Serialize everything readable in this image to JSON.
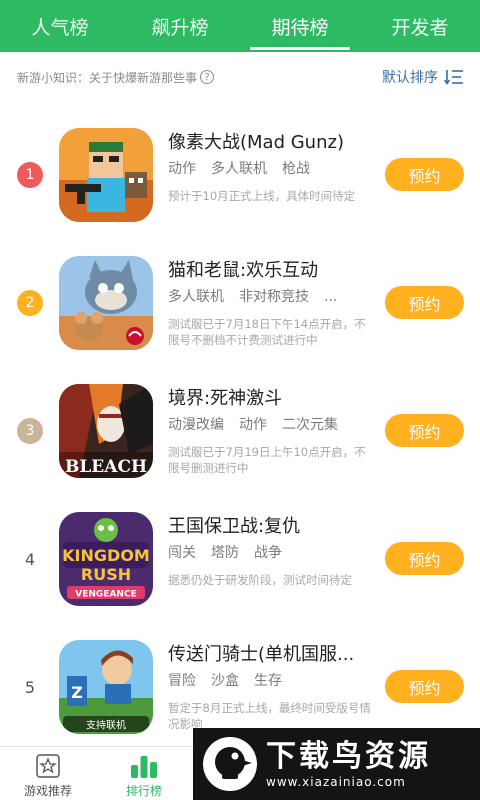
{
  "tabs": [
    {
      "label": "人气榜"
    },
    {
      "label": "飙升榜"
    },
    {
      "label": "期待榜",
      "active": true
    },
    {
      "label": "开发者"
    }
  ],
  "tip": {
    "text": "新游小知识：关于快爆新游那些事",
    "help_icon": "?"
  },
  "sort": {
    "label": "默认排序"
  },
  "items": [
    {
      "rank": "1",
      "rank_color": "#f05a5a",
      "title": "像素大战(Mad Gunz)",
      "tags": [
        "动作",
        "多人联机",
        "枪战"
      ],
      "desc": "预计于10月正式上线，具体时间待定",
      "button": "预约"
    },
    {
      "rank": "2",
      "rank_color": "#ffb11f",
      "title": "猫和老鼠:欢乐互动",
      "tags": [
        "多人联机",
        "非对称竞技",
        "..."
      ],
      "desc": "测试服已于7月18日下午14点开启，不限号不删档不计费测试进行中",
      "button": "预约"
    },
    {
      "rank": "3",
      "rank_color": "#c9b49a",
      "title": "境界:死神激斗",
      "tags": [
        "动漫改编",
        "动作",
        "二次元集"
      ],
      "desc": "测试服已于7月19日上午10点开启，不限号删测进行中",
      "button": "预约"
    },
    {
      "rank": "4",
      "rank_color": "",
      "title": "王国保卫战:复仇",
      "tags": [
        "闯关",
        "塔防",
        "战争"
      ],
      "desc": "据悉仍处于研发阶段，测试时间待定",
      "button": "预约"
    },
    {
      "rank": "5",
      "rank_color": "",
      "title": "传送门骑士(单机国服...",
      "tags": [
        "冒险",
        "沙盒",
        "生存"
      ],
      "desc": "暂定于8月正式上线，最终时间受版号情况影响",
      "button": "预约"
    }
  ],
  "icon_texts": {
    "bleach": "BLEACH",
    "kingdom1": "KINGDOM",
    "kingdom2": "RUSH",
    "kingdom3": "VENGEANCE",
    "portal_badge": "支持联机"
  },
  "bottom_nav": [
    {
      "label": "游戏推荐"
    },
    {
      "label": "排行榜",
      "active": true
    }
  ],
  "watermark": {
    "title": "下载鸟资源",
    "url": "www.xiazainiao.com"
  },
  "colors": {
    "accent": "#2dba62",
    "button": "#ffb11f",
    "sort_link": "#3b6ea8"
  }
}
